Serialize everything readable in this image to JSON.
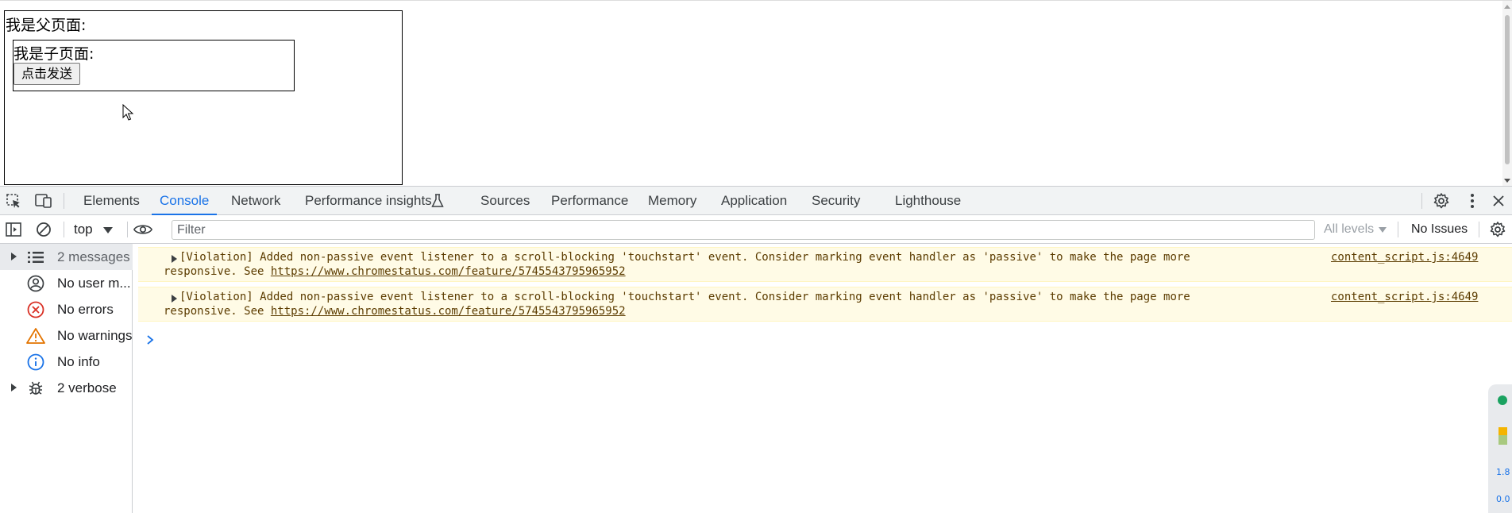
{
  "page": {
    "parent_label": "我是父页面:",
    "child_label": "我是子页面:",
    "send_button": "点击发送"
  },
  "devtools": {
    "tabs": [
      {
        "label": "Elements",
        "active": false
      },
      {
        "label": "Console",
        "active": true
      },
      {
        "label": "Network",
        "active": false
      },
      {
        "label": "Performance insights",
        "active": false
      },
      {
        "label": "Sources",
        "active": false
      },
      {
        "label": "Performance",
        "active": false
      },
      {
        "label": "Memory",
        "active": false
      },
      {
        "label": "Application",
        "active": false
      },
      {
        "label": "Security",
        "active": false
      },
      {
        "label": "Lighthouse",
        "active": false
      }
    ],
    "toolbar": {
      "context": "top",
      "filter_placeholder": "Filter",
      "levels": "All levels",
      "issues": "No Issues"
    },
    "sidebar": [
      {
        "label": "2 messages",
        "icon": "list-icon"
      },
      {
        "label": "No user m...",
        "icon": "user-icon"
      },
      {
        "label": "No errors",
        "icon": "error-icon"
      },
      {
        "label": "No warnings",
        "icon": "warning-icon"
      },
      {
        "label": "No info",
        "icon": "info-icon"
      },
      {
        "label": "2 verbose",
        "icon": "bug-icon"
      }
    ],
    "messages": [
      {
        "text_line1": "[Violation] Added non-passive event listener to a scroll-blocking 'touchstart' event. Consider marking event handler as 'passive' to make the page more",
        "text_line2_prefix": "responsive. See ",
        "link": "https://www.chromestatus.com/feature/5745543795965952",
        "source": "content_script.js:4649"
      },
      {
        "text_line1": "[Violation] Added non-passive event listener to a scroll-blocking 'touchstart' event. Consider marking event handler as 'passive' to make the page more",
        "text_line2_prefix": "responsive. See ",
        "link": "https://www.chromestatus.com/feature/5745543795965952",
        "source": "content_script.js:4649"
      }
    ],
    "perf_widget": {
      "value1": "1.8",
      "value2": "0.0"
    }
  },
  "colors": {
    "accent": "#1a73e8",
    "warning_bg": "#fffbe6",
    "warning_text": "#5c3c00"
  }
}
